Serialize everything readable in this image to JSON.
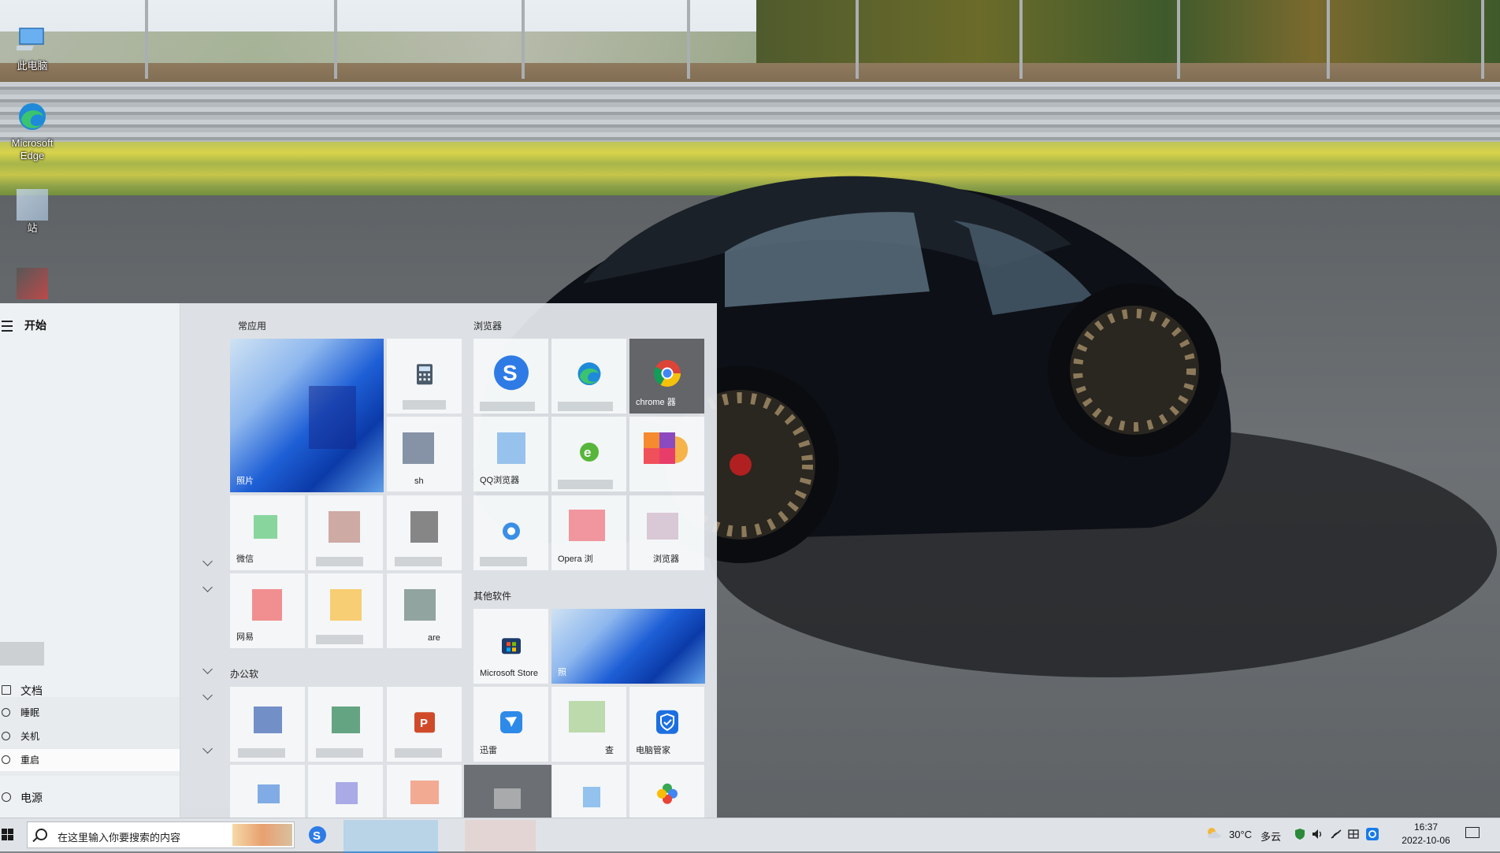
{
  "desktop": {
    "icons": [
      {
        "label": "此电脑",
        "icon": "this-pc-icon"
      },
      {
        "label": "Microsoft Edge",
        "icon": "edge-icon"
      },
      {
        "label": "站",
        "icon": "blurred-app-icon"
      },
      {
        "label": "",
        "icon": "blurred-app-icon"
      }
    ]
  },
  "start_menu": {
    "title": "开始",
    "left_items": [
      {
        "label": "文档",
        "icon": "document-icon"
      },
      {
        "label": "电源",
        "icon": "power-icon"
      }
    ],
    "power_menu": [
      {
        "label": "睡眠",
        "icon": "sleep-icon",
        "selected": false
      },
      {
        "label": "关机",
        "icon": "power-icon",
        "selected": false
      },
      {
        "label": "重启",
        "icon": "restart-icon",
        "selected": true
      }
    ],
    "groups": {
      "common": "常应用",
      "browsers": "浏览器",
      "other": "其他软件",
      "office": "办公软"
    },
    "tiles": {
      "photos": "照片",
      "wechat": "微信",
      "netease": "网易",
      "chrome": "chrome 器",
      "qq_browser": "QQ浏览器",
      "opera": "Opera 浏",
      "browser3": "浏览器",
      "store": "Microsoft Store",
      "photos2": "照",
      "xunlei": "迅雷",
      "pc_manager": "电脑管家",
      "tool1": "are",
      "tool2": "查",
      "tool3": "sh"
    }
  },
  "taskbar": {
    "search_placeholder": "在这里输入你要搜索的内容",
    "weather_temp": "30°C",
    "weather_text": "多云",
    "time": "16:37",
    "date": "2022-10-06"
  },
  "colors": {
    "accent": "#0067c0",
    "start_bg": "#e4e8ec",
    "taskbar_bg": "#dfe3e8"
  }
}
